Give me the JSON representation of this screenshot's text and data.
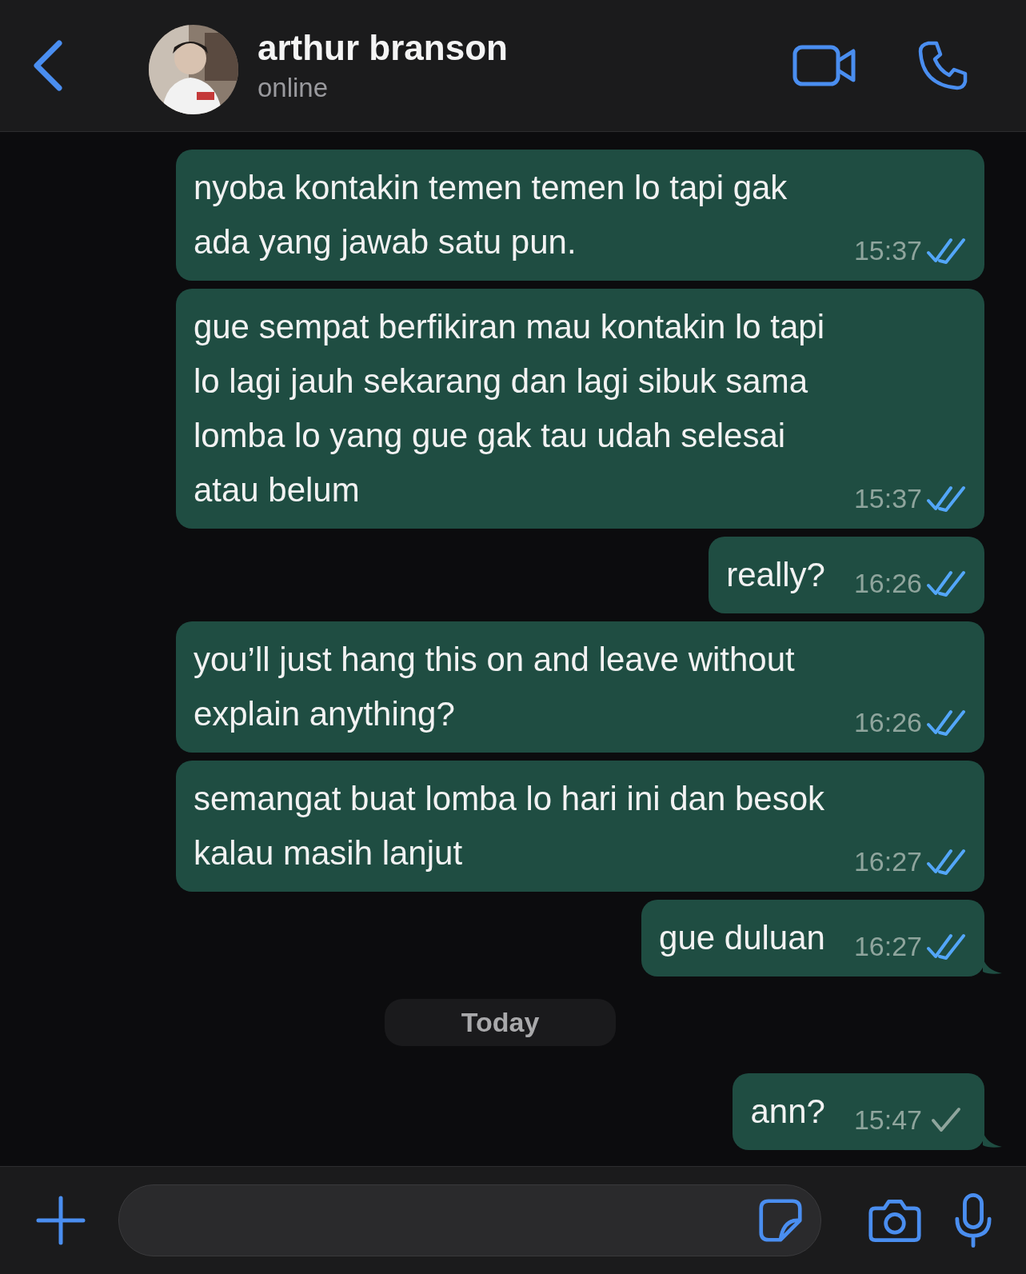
{
  "header": {
    "contact_name": "arthur branson",
    "status": "online"
  },
  "messages": [
    {
      "kind": "message",
      "text": "nyoba kontakin temen temen lo tapi gak ada yang jawab satu pun.",
      "time": "15:37",
      "read": true,
      "tail": false
    },
    {
      "kind": "message",
      "text": "gue sempat berfikiran mau kontakin lo tapi lo lagi jauh sekarang dan lagi sibuk sama lomba lo yang gue gak tau udah selesai atau belum",
      "time": "15:37",
      "read": true,
      "tail": false
    },
    {
      "kind": "message",
      "text": "really?",
      "time": "16:26",
      "read": true,
      "tail": false
    },
    {
      "kind": "message",
      "text": "you’ll just hang this on and leave without explain anything?",
      "time": "16:26",
      "read": true,
      "tail": false
    },
    {
      "kind": "message",
      "text": "semangat buat lomba lo hari ini dan besok kalau masih lanjut",
      "time": "16:27",
      "read": true,
      "tail": false
    },
    {
      "kind": "message",
      "text": "gue duluan",
      "time": "16:27",
      "read": true,
      "tail": true
    },
    {
      "kind": "date",
      "label": "Today"
    },
    {
      "kind": "message",
      "text": "ann?",
      "time": "15:47",
      "read": false,
      "tail": true
    }
  ]
}
